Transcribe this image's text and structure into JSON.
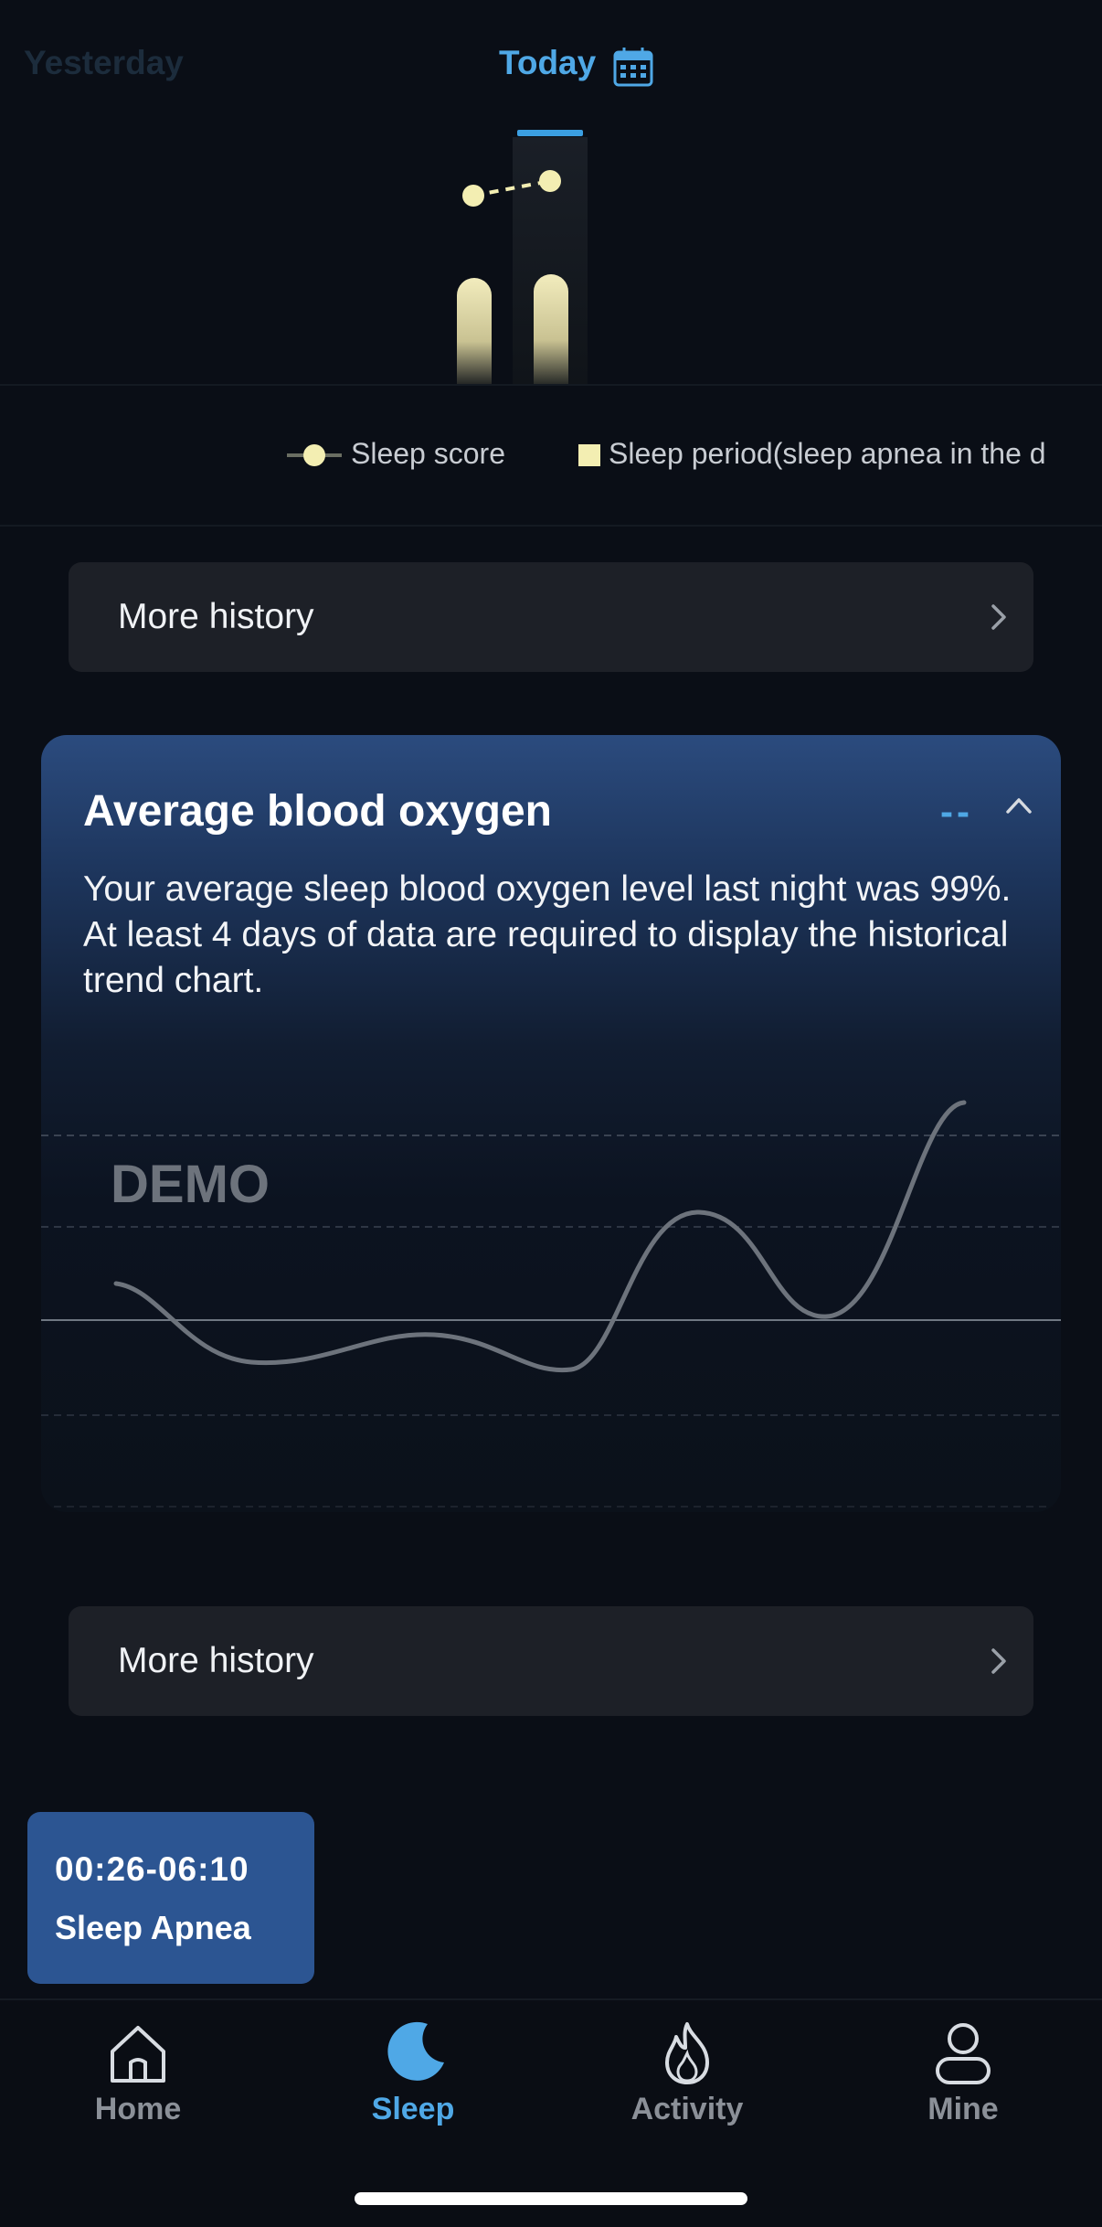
{
  "date_tabs": {
    "yesterday": "Yesterday",
    "today": "Today"
  },
  "legend": {
    "sleep_score": "Sleep score",
    "sleep_period": "Sleep period(sleep apnea in the d"
  },
  "more_history_label": "More history",
  "card": {
    "title": "Average blood oxygen",
    "value": "--",
    "description": "Your average sleep blood oxygen level last night was 99%. At least 4 days of data are required to display the historical trend chart.",
    "demo_label": "DEMO"
  },
  "apnea_badge": {
    "time": "00:26-06:10",
    "label": "Sleep Apnea"
  },
  "nav": {
    "home": "Home",
    "sleep": "Sleep",
    "activity": "Activity",
    "mine": "Mine"
  },
  "colors": {
    "accent": "#4fa8e6",
    "sleep_score": "#f3eeb2",
    "badge": "#2c5592"
  }
}
